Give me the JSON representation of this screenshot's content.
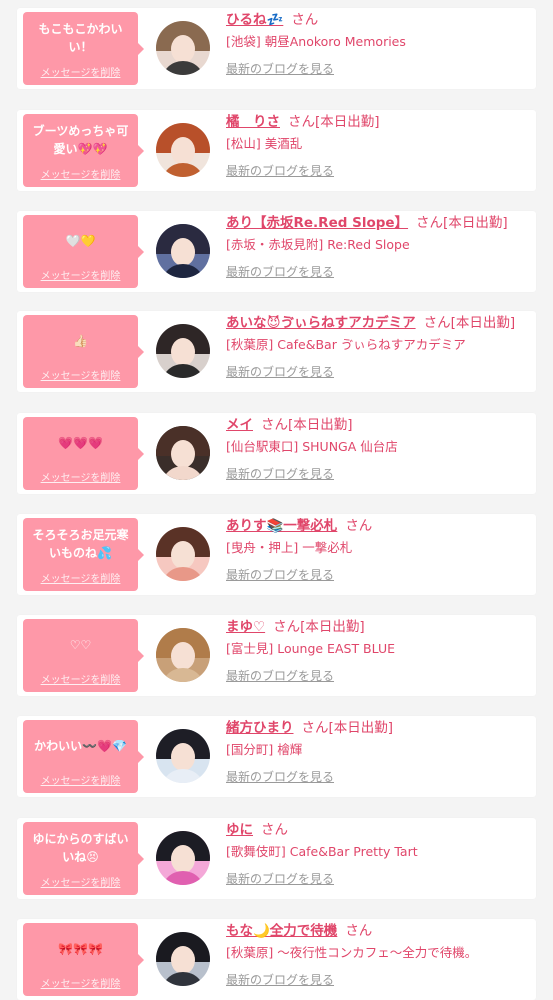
{
  "items": [
    {
      "message": "もこもこかわいい！",
      "delete_label": "メッセージを削除",
      "name": "ひるね💤",
      "san": "さん",
      "status": "",
      "shop": "[池袋] 朝昼Anokoro Memories",
      "blog_link": "最新のブログを見る",
      "avatar_colors": {
        "bg": "#e8d8d0",
        "hair": "#8a6a50",
        "body": "#3b3b3b"
      }
    },
    {
      "message": "ブーツめっちゃ可愛い💖💖",
      "delete_label": "メッセージを削除",
      "name": "橘　りさ",
      "san": "さん",
      "status": "[本日出勤]",
      "shop": "[松山] 美酒乱",
      "blog_link": "最新のブログを見る",
      "avatar_colors": {
        "bg": "#f0e4dc",
        "hair": "#b8502a",
        "body": "#c06030"
      }
    },
    {
      "message": "🤍💛",
      "delete_label": "メッセージを削除",
      "name": "あり【赤坂Re.Red Slope】",
      "san": "さん",
      "status": "[本日出勤]",
      "shop": "[赤坂・赤坂見附] Re:Red Slope",
      "blog_link": "最新のブログを見る",
      "avatar_colors": {
        "bg": "#6070a0",
        "hair": "#2a2a40",
        "body": "#1e2640"
      }
    },
    {
      "message": "👍🏻",
      "delete_label": "メッセージを削除",
      "name": "あいな😈ゔぃらねすアカデミア",
      "san": "さん",
      "status": "[本日出勤]",
      "shop": "[秋葉原] Cafe&Bar ゔぃらねすアカデミア",
      "blog_link": "最新のブログを見る",
      "avatar_colors": {
        "bg": "#d8d0cc",
        "hair": "#2e2626",
        "body": "#2a2a2a"
      }
    },
    {
      "message": "💗💗💗",
      "delete_label": "メッセージを削除",
      "name": "メイ",
      "san": "さん",
      "status": "[本日出勤]",
      "shop": "[仙台駅東口] SHUNGA 仙台店",
      "blog_link": "最新のブログを見る",
      "avatar_colors": {
        "bg": "#3a2e2a",
        "hair": "#4a3028",
        "body": "#f2d8cc"
      }
    },
    {
      "message": "そろそろお足元寒いものね💦",
      "delete_label": "メッセージを削除",
      "name": "ありす📚一撃必札",
      "san": "さん",
      "status": "",
      "shop": "[曳舟・押上] 一撃必札",
      "blog_link": "最新のブログを見る",
      "avatar_colors": {
        "bg": "#f6c8c0",
        "hair": "#5a3226",
        "body": "#e89888"
      }
    },
    {
      "message": "♡♡",
      "delete_label": "メッセージを削除",
      "name": "まゆ♡",
      "san": "さん",
      "status": "[本日出勤]",
      "shop": "[富士見] Lounge EAST BLUE",
      "blog_link": "最新のブログを見る",
      "avatar_colors": {
        "bg": "#c8a078",
        "hair": "#b07c4a",
        "body": "#d8b894"
      }
    },
    {
      "message": "かわいい〰️💗💎",
      "delete_label": "メッセージを削除",
      "name": "緒方ひまり",
      "san": "さん",
      "status": "[本日出勤]",
      "shop": "[国分町] 檜輝",
      "blog_link": "最新のブログを見る",
      "avatar_colors": {
        "bg": "#d8e4f0",
        "hair": "#1e1e26",
        "body": "#e8eef6"
      }
    },
    {
      "message": "ゆにからのすばいいね😣",
      "delete_label": "メッセージを削除",
      "name": "ゆに",
      "san": "さん",
      "status": "",
      "shop": "[歌舞伎町] Cafe&Bar Pretty Tart",
      "blog_link": "最新のブログを見る",
      "avatar_colors": {
        "bg": "#f4a8d8",
        "hair": "#1c1c24",
        "body": "#e060b0"
      }
    },
    {
      "message": "🎀🎀🎀",
      "delete_label": "メッセージを削除",
      "name": "もな🌙全力で待機",
      "san": "さん",
      "status": "",
      "shop": "[秋葉原] 〜夜行性コンカフェ〜全力で待機。",
      "blog_link": "最新のブログを見る",
      "avatar_colors": {
        "bg": "#b8c0cc",
        "hair": "#1a1a20",
        "body": "#30343c"
      }
    }
  ]
}
